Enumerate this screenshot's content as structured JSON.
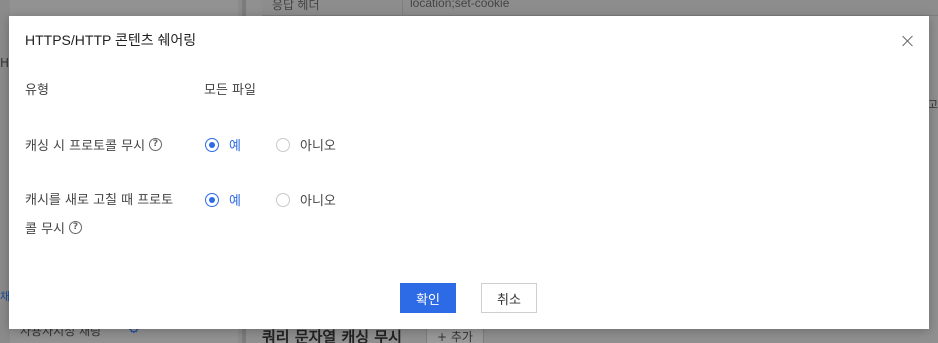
{
  "background": {
    "table_header_col1": "응답 헤더",
    "table_header_col2": "location;set-cookie",
    "left_cut_text": "HTI",
    "left_cut_text2": "채",
    "left_bottom_text": "사용자지정 채링",
    "right_cut_text": "고",
    "main_bottom_title": "쿼리 문자열 캐싱 무시",
    "main_bottom_add_button": "+ 추가"
  },
  "dialog": {
    "title": "HTTPS/HTTP 콘텐츠 쉐어링",
    "rows": [
      {
        "label": "유형",
        "value": "모든 파일"
      },
      {
        "label": "캐싱 시 프로토콜 무시",
        "help": "?",
        "options": [
          "예",
          "아니오"
        ],
        "selected": "예"
      },
      {
        "label_line1": "캐시를 새로 고칠 때 프로토",
        "label_line2": "콜 무시",
        "help": "?",
        "options": [
          "예",
          "아니오"
        ],
        "selected": "예"
      }
    ],
    "confirm_label": "확인",
    "cancel_label": "취소"
  },
  "colors": {
    "accent": "#2d6ae6",
    "overlay": "#8a8a8a"
  }
}
